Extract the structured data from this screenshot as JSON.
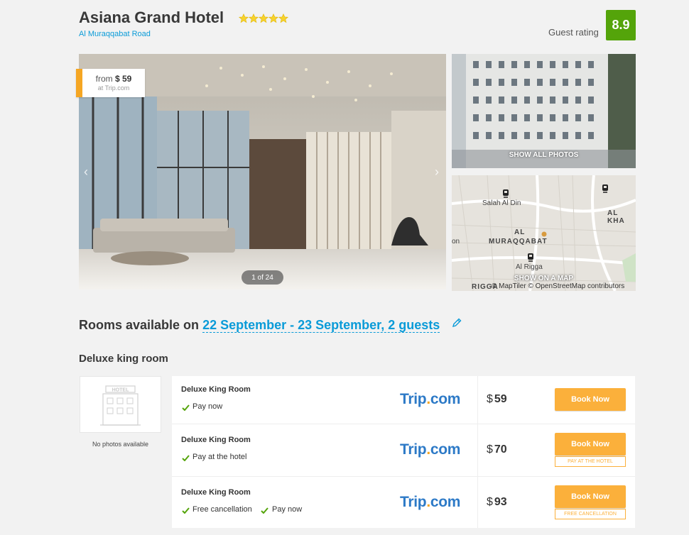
{
  "hotel": {
    "name": "Asiana Grand Hotel",
    "star_count": 5,
    "address": "Al Muraqqabat Road",
    "rating_label": "Guest rating",
    "rating": "8.9",
    "accent_color": "#0a9bd8",
    "rating_color": "#54a40a"
  },
  "gallery": {
    "price_from_label": "from",
    "price_currency": "$",
    "price_value": "59",
    "price_source": "at Trip.com",
    "counter": "1 of 24",
    "show_all_label": "SHOW ALL PHOTOS",
    "show_map_label": "SHOW ON A MAP",
    "map_credit": "© MapTiler © OpenStreetMap contributors",
    "map_labels": [
      "Salah Al Din",
      "AL",
      "MURAQQABAT",
      "Al Rigga",
      "AL KHA",
      "on",
      "RIGGA"
    ]
  },
  "rooms": {
    "heading_prefix": "Rooms available on",
    "dates": "22 September - 23 September, 2 guests",
    "room_type": "Deluxe king room",
    "no_photos": "No photos available",
    "offers": [
      {
        "title": "Deluxe King Room",
        "features": [
          "Pay now"
        ],
        "provider": "Trip",
        "provider_suffix": "com",
        "currency": "$",
        "price": "59",
        "button": "Book Now",
        "sub": ""
      },
      {
        "title": "Deluxe King Room",
        "features": [
          "Pay at the hotel"
        ],
        "provider": "Trip",
        "provider_suffix": "com",
        "currency": "$",
        "price": "70",
        "button": "Book Now",
        "sub": "PAY AT THE HOTEL"
      },
      {
        "title": "Deluxe King Room",
        "features": [
          "Free cancellation",
          "Pay now"
        ],
        "provider": "Trip",
        "provider_suffix": "com",
        "currency": "$",
        "price": "93",
        "button": "Book Now",
        "sub": "FREE CANCELLATION"
      }
    ]
  }
}
